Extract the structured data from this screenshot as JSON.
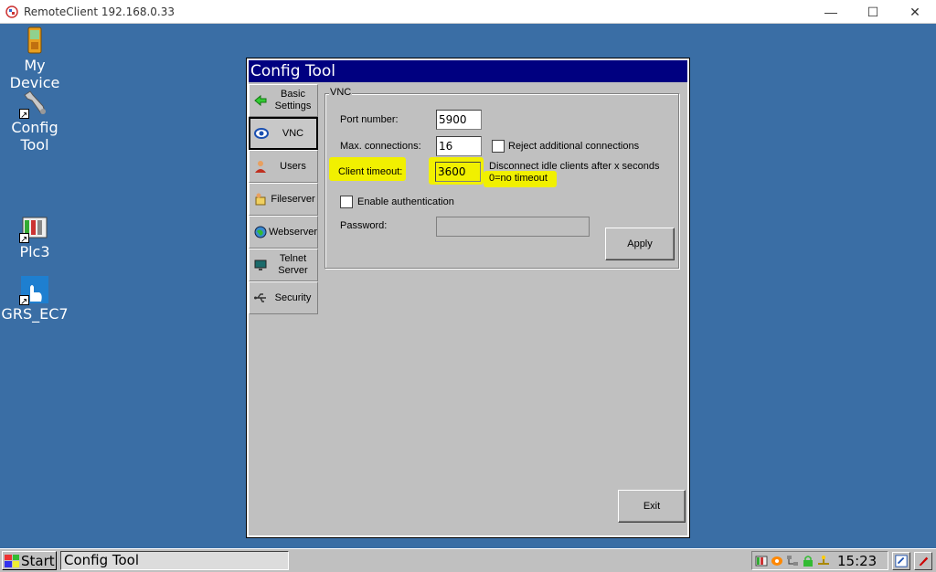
{
  "host": {
    "title": "RemoteClient 192.168.0.33",
    "controls": {
      "minimize": "—",
      "maximize": "☐",
      "close": "✕"
    }
  },
  "desktop": {
    "icons": [
      {
        "label": "My Device",
        "icon": "handheld-device-icon"
      },
      {
        "label": "Config\nTool",
        "icon": "wrench-icon"
      },
      {
        "label": "Plc3",
        "icon": "plc-icon"
      },
      {
        "label": "GRS_EC7",
        "icon": "touch-hand-icon"
      }
    ]
  },
  "config_window": {
    "title": "Config Tool",
    "tabs": [
      {
        "label": "Basic Settings",
        "icon": "green-arrow-icon"
      },
      {
        "label": "VNC",
        "icon": "vnc-eye-icon"
      },
      {
        "label": "Users",
        "icon": "user-icon"
      },
      {
        "label": "Fileserver",
        "icon": "fileserver-icon"
      },
      {
        "label": "Webserver",
        "icon": "globe-icon"
      },
      {
        "label": "Telnet Server",
        "icon": "monitor-icon"
      },
      {
        "label": "Security",
        "icon": "usb-icon"
      }
    ],
    "active_tab": "VNC",
    "vnc": {
      "group_label": "VNC",
      "port_label": "Port number:",
      "port_value": "5900",
      "maxconn_label": "Max. connections:",
      "maxconn_value": "16",
      "reject_label": "Reject additional connections",
      "reject_checked": false,
      "timeout_label": "Client timeout:",
      "timeout_value": "3600",
      "timeout_hint_1": "Disconnect idle clients after x seconds",
      "timeout_hint_2": "0=no timeout",
      "auth_label": "Enable authentication",
      "auth_checked": false,
      "password_label": "Password:",
      "password_value": "",
      "apply_label": "Apply"
    },
    "exit_label": "Exit"
  },
  "taskbar": {
    "start_label": "Start",
    "task_item": "Config Tool",
    "time": "15:23"
  },
  "colors": {
    "desktop": "#3a6ea5",
    "title_active": "#000080",
    "highlight": "#f1f000",
    "window_face": "#c0c0c0"
  }
}
